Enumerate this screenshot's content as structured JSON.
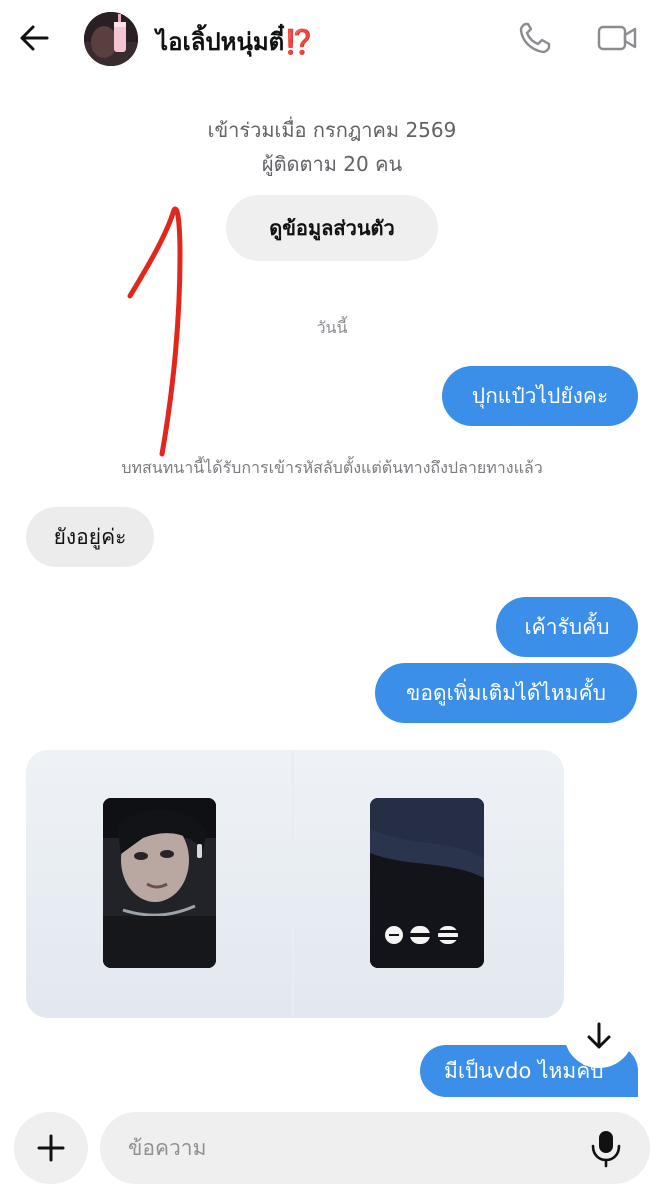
{
  "header": {
    "contact_name": "ไอเลิ้ปหนุ่มตี๋",
    "name_emoji": "⁉️",
    "back_icon": "arrow-left-icon",
    "call_icon": "phone-icon",
    "video_icon": "video-camera-icon"
  },
  "profile": {
    "joined": "เข้าร่วมเมื่อ กรกฎาคม 2569",
    "followers": "ผู้ติดตาม 20 คน",
    "view_profile_label": "ดูข้อมูลส่วนตัว"
  },
  "conversation": {
    "date_divider": "วันนี้",
    "system_note": "บทสนทนานี้ได้รับการเข้ารหัสลับตั้งแต่ต้นทางถึงปลายทางแล้ว",
    "messages": [
      {
        "direction": "outgoing",
        "text": "ปุกแป๋วไปยังคะ"
      },
      {
        "direction": "incoming",
        "text": "ยังอยู่ค่ะ"
      },
      {
        "direction": "outgoing",
        "text": "เค้ารับคั้บ"
      },
      {
        "direction": "outgoing",
        "text": "ขอดูเพิ่มเติมได้ไหมคั้บ"
      },
      {
        "direction": "incoming",
        "type": "photos",
        "count": 2
      },
      {
        "direction": "outgoing",
        "text": "มีเป็นvdo ไหมคั้บ"
      }
    ]
  },
  "composer": {
    "placeholder": "ข้อความ",
    "add_icon": "plus-icon",
    "mic_icon": "microphone-icon"
  },
  "colors": {
    "outgoing_bubble": "#3b8fe8",
    "incoming_bubble": "#ececec",
    "annotation": "#e3261c"
  }
}
